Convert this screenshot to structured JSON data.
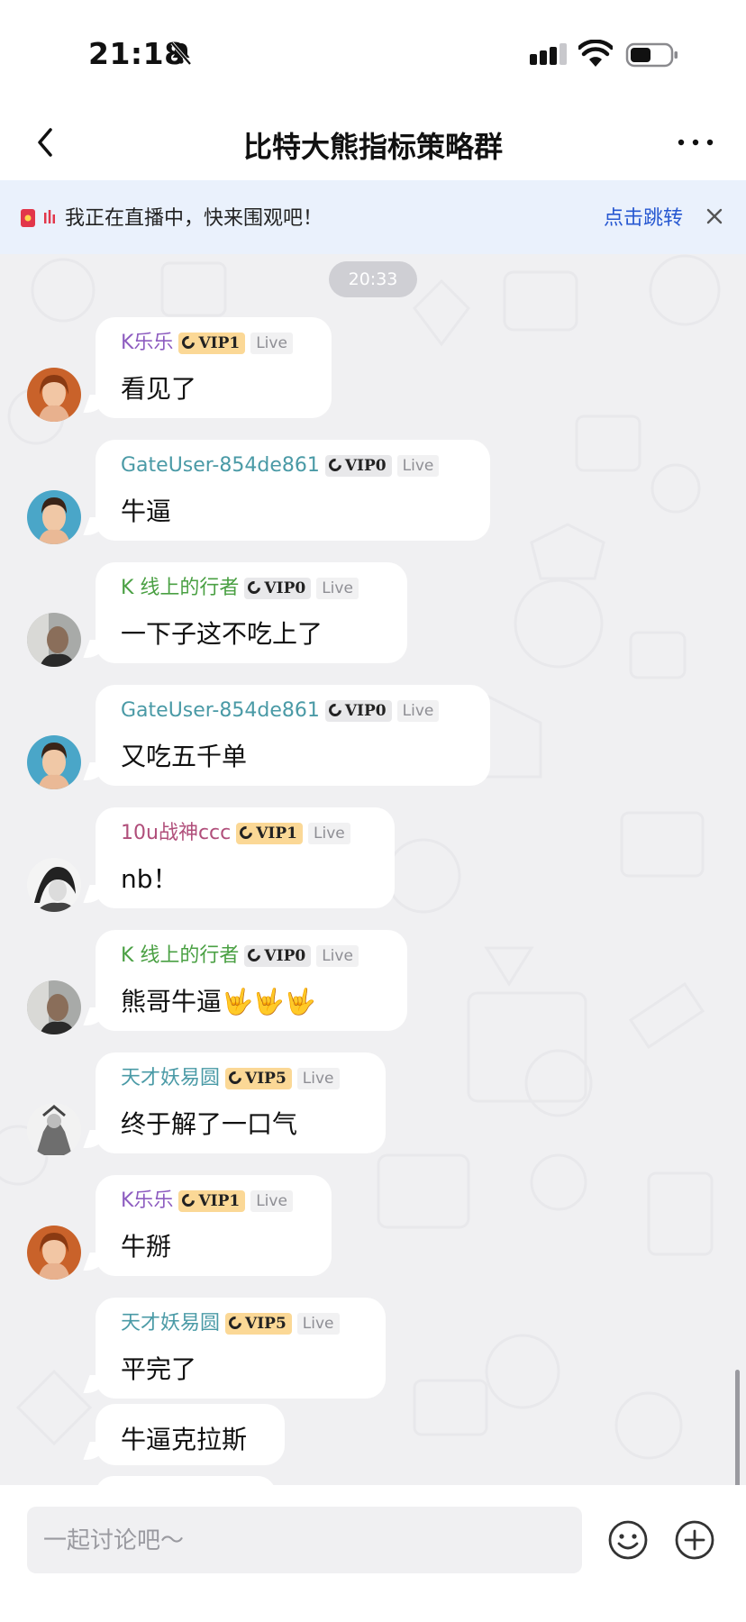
{
  "status_bar": {
    "time": "21:18",
    "icons": [
      "bell-muted-icon",
      "signal-icon",
      "wifi-icon",
      "battery-icon"
    ]
  },
  "header": {
    "title": "比特大熊指标策略群",
    "icons": [
      "back-arrow-icon",
      "more-icon"
    ]
  },
  "banner": {
    "text": "我正在直播中，快来围观吧！",
    "action": "点击跳转",
    "icons": [
      "live-icon",
      "audio-bars-icon",
      "close-icon"
    ]
  },
  "chat": {
    "timestamp": "20:33",
    "messages": [
      {
        "name": "K乐乐",
        "name_color": "#8d5cc0",
        "vip": "VIP1",
        "vip_style": "gold",
        "tag": "Live",
        "text": "看见了",
        "avatar": "avatar-woman-red-hair"
      },
      {
        "name": "GateUser-854de861",
        "name_color": "#4a9aa6",
        "vip": "VIP0",
        "vip_style": "grey",
        "tag": "Live",
        "text": "牛逼",
        "avatar": "avatar-man-dark-hair"
      },
      {
        "name": "K 线上的行者",
        "name_color": "#4aa043",
        "vip": "VIP0",
        "vip_style": "grey",
        "tag": "Live",
        "text": "一下子这不吃上了",
        "avatar": "avatar-man-photo"
      },
      {
        "name": "GateUser-854de861",
        "name_color": "#4a9aa6",
        "vip": "VIP0",
        "vip_style": "grey",
        "tag": "Live",
        "text": "又吃五千单",
        "avatar": "avatar-man-dark-hair"
      },
      {
        "name": "10u战神ccc",
        "name_color": "#b04e7a",
        "vip": "VIP1",
        "vip_style": "gold",
        "tag": "Live",
        "text": "nb！",
        "avatar": "avatar-anime-sketch"
      },
      {
        "name": "K 线上的行者",
        "name_color": "#4aa043",
        "vip": "VIP0",
        "vip_style": "grey",
        "tag": "Live",
        "text": "熊哥牛逼🤟🤟🤟",
        "avatar": "avatar-man-photo"
      },
      {
        "name": "天才妖易圆",
        "name_color": "#4a9aa6",
        "vip": "VIP5",
        "vip_style": "gold",
        "tag": "Live",
        "text": "终于解了一口气",
        "avatar": "avatar-warrior-figure"
      },
      {
        "name": "K乐乐",
        "name_color": "#8d5cc0",
        "vip": "VIP1",
        "vip_style": "gold",
        "tag": "Live",
        "text": "牛掰",
        "avatar": "avatar-woman-red-hair"
      },
      {
        "name": "天才妖易圆",
        "name_color": "#4a9aa6",
        "vip": "VIP5",
        "vip_style": "gold",
        "tag": "Live",
        "text": "平完了",
        "avatar": ""
      },
      {
        "name": "",
        "text": "牛逼克拉斯",
        "avatar": ""
      }
    ]
  },
  "input": {
    "placeholder": "一起讨论吧～",
    "icons": [
      "emoji-icon",
      "plus-icon"
    ]
  }
}
